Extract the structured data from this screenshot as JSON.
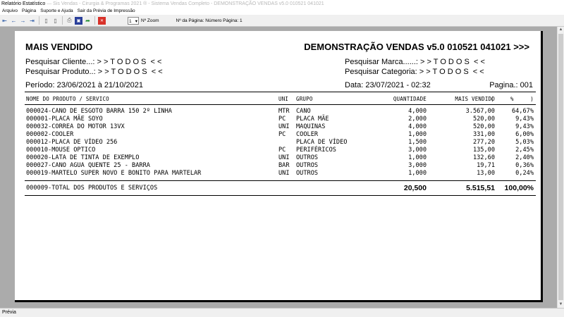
{
  "window": {
    "title": "Relatório Estatístico",
    "title_faded": "— Sis Vendas - Cirurgia & Programas 2021 ® - Sistema Vendas Completo - DEMONSTRAÇÃO VENDAS v5.0 010521 041021"
  },
  "menu": [
    "Arquivo",
    "Página",
    "Suporte e Ajuda",
    "Sair da Prévia de Impressão"
  ],
  "toolbar": {
    "zoom_value": "1",
    "zoom_label": "Nº Zoom",
    "page_label": "Nº da Página: Número Página: 1",
    "icons": [
      "first-page-icon",
      "prev-page-icon",
      "next-page-icon",
      "last-page-icon",
      "single-page-icon",
      "two-pages-icon",
      "print-icon",
      "save-icon",
      "export-icon",
      "close-icon"
    ]
  },
  "report": {
    "title": "MAIS VENDIDO",
    "header_right": "DEMONSTRAÇÃO VENDAS v5.0 010521 041021 >>>",
    "filter_cliente": "Pesquisar Cliente...: > > T O D O S  < <",
    "filter_produto": "Pesquisar Produto..: > > T O D O S  < <",
    "filter_marca": "Pesquisar Marca......: > > T O D O S  < <",
    "filter_categoria": "Pesquisar Categoria: > > T O D O S  < <",
    "periodo": "Período: 23/06/2021 à 21/10/2021",
    "data": "Data: 23/07/2021 - 02:32",
    "pagina": "Pagina.: 001",
    "columns": {
      "produto": "NOME DO PRODUTO / SERVICO",
      "uni": "UNI",
      "grupo": "GRUPO",
      "quantidade": "QUANTIDADE",
      "mais_vendido": "MAIS VENDIDO",
      "pct": "(     %     )"
    },
    "rows": [
      {
        "produto": "000024-CANO DE ESGOTO BARRA 150 2º LINHA",
        "uni": "MTR",
        "grupo": "CANO",
        "qtd": "4,000",
        "valor": "3.567,00",
        "pct": "64,67%"
      },
      {
        "produto": "000001-PLACA MÃE SOYO",
        "uni": "PC",
        "grupo": "PLACA MÃE",
        "qtd": "2,000",
        "valor": "520,00",
        "pct": "9,43%"
      },
      {
        "produto": "000032-CORREA DO MOTOR 13VX",
        "uni": "UNI",
        "grupo": "MAQUINAS",
        "qtd": "4,000",
        "valor": "520,00",
        "pct": "9,43%"
      },
      {
        "produto": "000002-COOLER",
        "uni": "PC",
        "grupo": "COOLER",
        "qtd": "1,000",
        "valor": "331,00",
        "pct": "6,00%"
      },
      {
        "produto": "000012-PLACA DE VÍDEO 256",
        "uni": "",
        "grupo": "PLACA DE VÍDEO",
        "qtd": "1,500",
        "valor": "277,20",
        "pct": "5,03%"
      },
      {
        "produto": "000010-MOUSE OPTICO",
        "uni": "PC",
        "grupo": "PERIFÉRICOS",
        "qtd": "3,000",
        "valor": "135,00",
        "pct": "2,45%"
      },
      {
        "produto": "000020-LATA DE TINTA DE EXEMPLO",
        "uni": "UNI",
        "grupo": "OUTROS",
        "qtd": "1,000",
        "valor": "132,60",
        "pct": "2,40%"
      },
      {
        "produto": "000027-CANO AGUA QUENTE 25 - BARRA",
        "uni": "BAR",
        "grupo": "OUTROS",
        "qtd": "3,000",
        "valor": "19,71",
        "pct": "0,36%"
      },
      {
        "produto": "000019-MARTELO SUPER NOVO E BONITO PARA MARTELAR",
        "uni": "UNI",
        "grupo": "OUTROS",
        "qtd": "1,000",
        "valor": "13,00",
        "pct": "0,24%"
      }
    ],
    "total": {
      "label": "000009-TOTAL DOS PRODUTOS E SERVIÇOS",
      "qtd": "20,500",
      "valor": "5.515,51",
      "pct": "100,00%"
    }
  },
  "status": "Prévia"
}
